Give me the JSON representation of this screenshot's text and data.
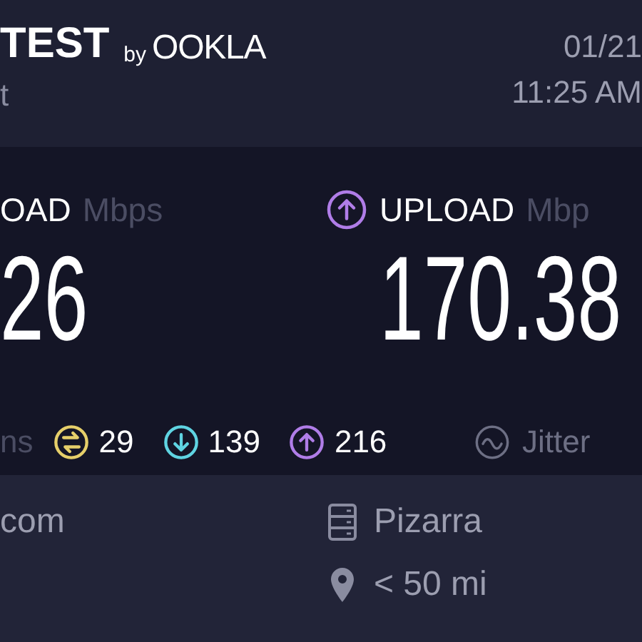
{
  "header": {
    "brand": "TEST",
    "brand_by": "by",
    "brand_company": "OOKLA",
    "subtitle": "t",
    "date": "01/21",
    "time": "11:25 AM"
  },
  "results": [
    {
      "kind": "download",
      "label": "OAD",
      "unit": "Mbps",
      "value": "26"
    },
    {
      "kind": "upload",
      "label": "UPLOAD",
      "unit": "Mbp",
      "value": "170.38"
    }
  ],
  "latency": {
    "unit": "ns",
    "pings": [
      {
        "kind": "idle",
        "value": "29",
        "color": "#e6cf6a"
      },
      {
        "kind": "download",
        "value": "139",
        "color": "#5fd4e2"
      },
      {
        "kind": "upload",
        "value": "216",
        "color": "#b07de8"
      }
    ],
    "jitter_label": "Jitter"
  },
  "footer": {
    "left": [
      "com"
    ],
    "right": [
      {
        "kind": "server",
        "text": "Pizarra"
      },
      {
        "kind": "location",
        "text": "< 50 mi"
      }
    ]
  }
}
